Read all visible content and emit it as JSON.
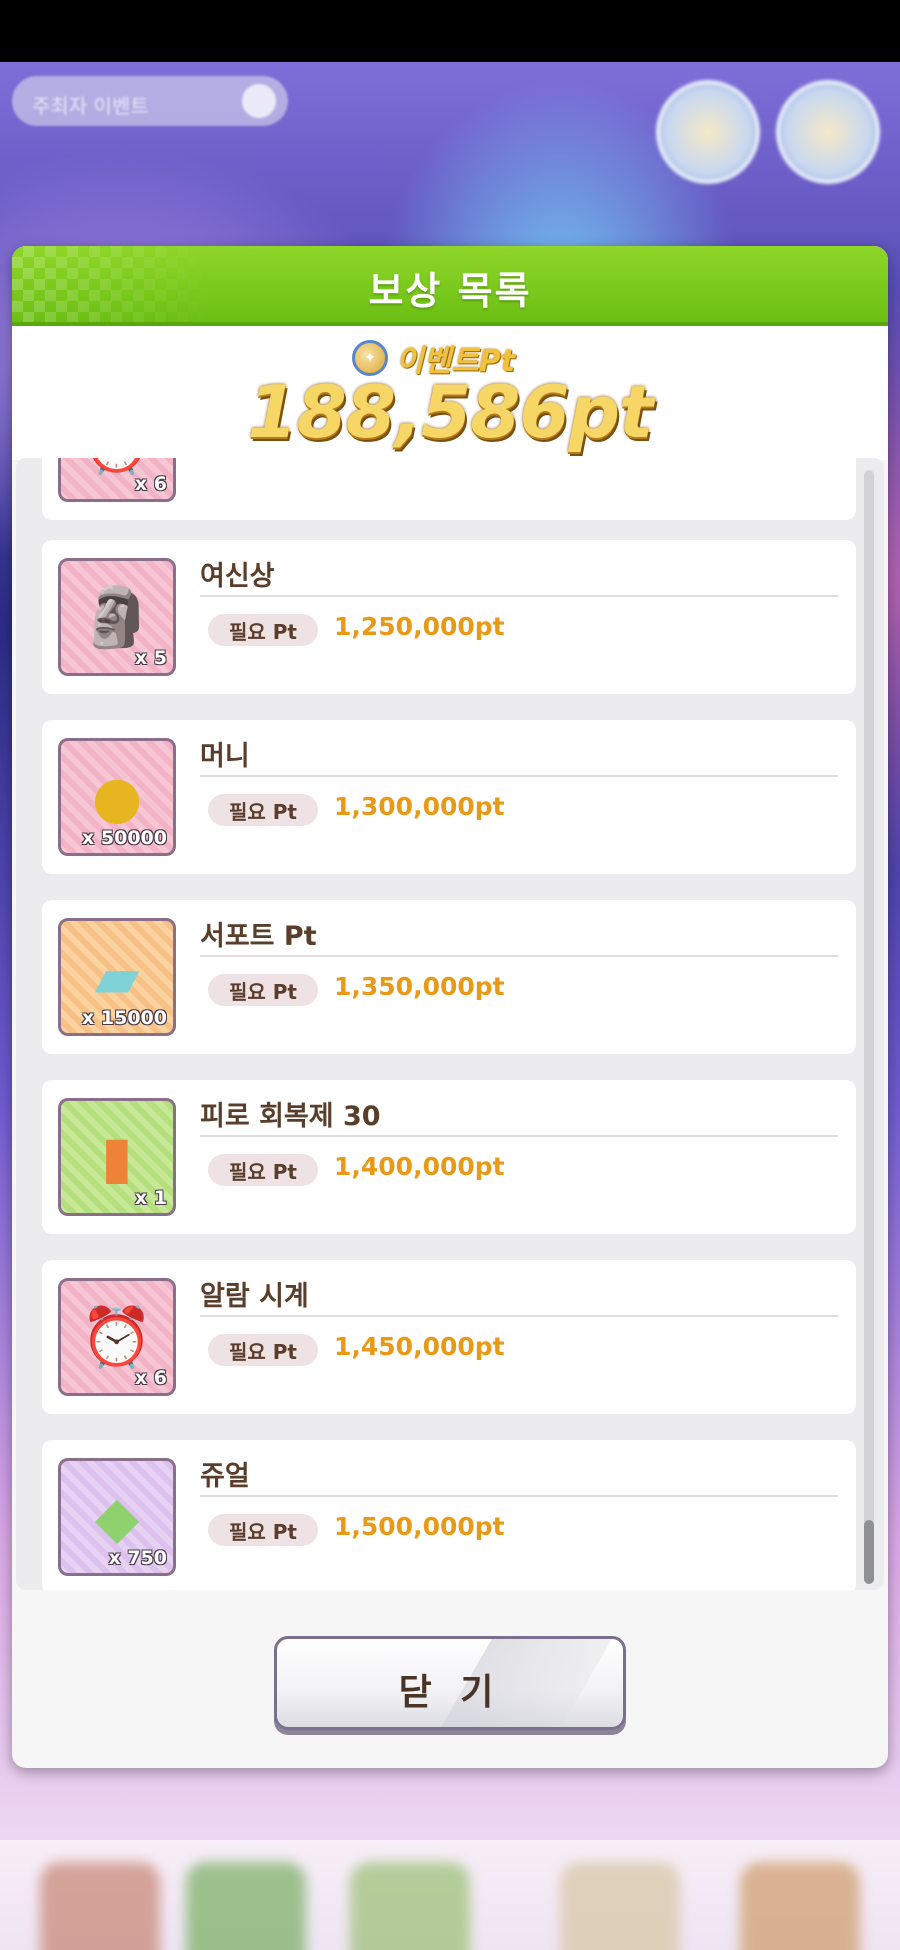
{
  "background": {
    "top_left_pill_text": "주최자 이벤트",
    "bottom_nav": [
      "",
      "",
      "",
      "",
      ""
    ]
  },
  "modal": {
    "title": "보상 목록",
    "event_label": "이벤트Pt",
    "event_points": "188,586pt",
    "close_label": "닫 기",
    "required_label": "필요 Pt",
    "rewards": [
      {
        "name": "",
        "qty": "x 6",
        "required": "",
        "icon": "alarm-clock-icon"
      },
      {
        "name": "여신상",
        "qty": "x 5",
        "required": "1,250,000pt",
        "icon": "goddess-statue-icon"
      },
      {
        "name": "머니",
        "qty": "x 50000",
        "required": "1,300,000pt",
        "icon": "money-coin-icon"
      },
      {
        "name": "서포트 Pt",
        "qty": "x 15000",
        "required": "1,350,000pt",
        "icon": "support-pt-icon"
      },
      {
        "name": "피로 회복제 30",
        "qty": "x 1",
        "required": "1,400,000pt",
        "icon": "tp-bottle-icon"
      },
      {
        "name": "알람 시계",
        "qty": "x 6",
        "required": "1,450,000pt",
        "icon": "alarm-clock-icon"
      },
      {
        "name": "쥬얼",
        "qty": "x 750",
        "required": "1,500,000pt",
        "icon": "jewel-icon"
      }
    ]
  },
  "colors": {
    "header_green": "#7ccb1c",
    "points_gold": "#f6d766",
    "required_orange": "#e89a16",
    "text_brown": "#5a3e2b"
  }
}
